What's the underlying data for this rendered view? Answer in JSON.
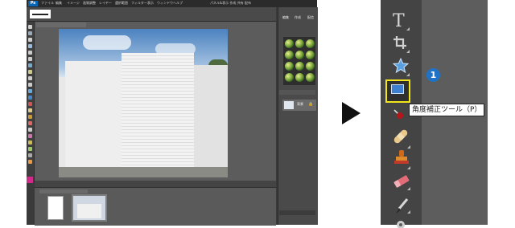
{
  "app": {
    "menu_items": [
      "ファイル",
      "編集",
      "イメージ",
      "画質調整",
      "レイヤー",
      "選択範囲",
      "フィルター",
      "表示",
      "ウィンドウ",
      "ヘルプ"
    ],
    "top_right_items": [
      "パネル&表示",
      "作成",
      "共有",
      "配布"
    ],
    "panel_tabs": [
      "編集",
      "作成",
      "配信"
    ],
    "layer_name": "背景",
    "accent_color": "#0a64b4"
  },
  "zoom": {
    "badge_number": "1",
    "tooltip_label": "角度補正ツール（P）",
    "highlight_color": "#f2e51b",
    "badge_color": "#1f73c7",
    "icons": [
      "type-icon",
      "crop-icon",
      "shape-icon",
      "straighten-icon",
      "red-eye-icon",
      "spot-healing-icon",
      "clone-stamp-icon",
      "eraser-icon",
      "brush-icon",
      "gear-icon"
    ]
  }
}
